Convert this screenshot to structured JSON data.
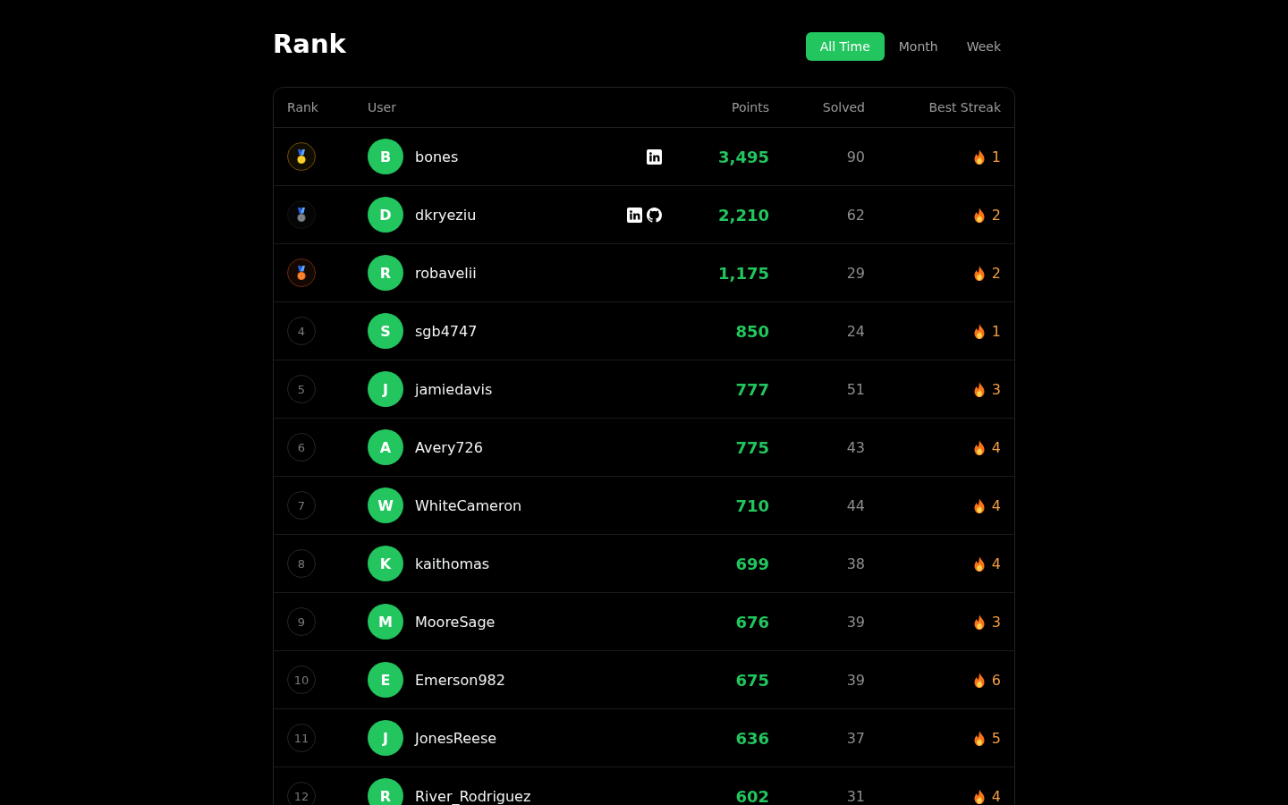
{
  "page": {
    "title": "Rank"
  },
  "tabs": [
    {
      "label": "All Time",
      "selected": true
    },
    {
      "label": "Month",
      "selected": false
    },
    {
      "label": "Week",
      "selected": false
    }
  ],
  "table": {
    "columns": [
      "Rank",
      "User",
      "Points",
      "Solved",
      "Best Streak"
    ],
    "rows": [
      {
        "rank": {
          "kind": "gold"
        },
        "initial": "B",
        "user": "bones",
        "links": [
          {
            "kind": "linkedin"
          }
        ],
        "points": "3,495",
        "solved": "90",
        "streak": "1"
      },
      {
        "rank": {
          "kind": "silver"
        },
        "initial": "D",
        "user": "dkryeziu",
        "links": [
          {
            "kind": "linkedin"
          },
          {
            "kind": "github"
          }
        ],
        "points": "2,210",
        "solved": "62",
        "streak": "2"
      },
      {
        "rank": {
          "kind": "bronze"
        },
        "initial": "R",
        "user": "robavelii",
        "points": "1,175",
        "solved": "29",
        "streak": "2"
      },
      {
        "rank": {
          "kind": "number",
          "label": "4"
        },
        "initial": "S",
        "user": "sgb4747",
        "points": "850",
        "solved": "24",
        "streak": "1"
      },
      {
        "rank": {
          "kind": "number",
          "label": "5"
        },
        "initial": "J",
        "user": "jamiedavis",
        "points": "777",
        "solved": "51",
        "streak": "3"
      },
      {
        "rank": {
          "kind": "number",
          "label": "6"
        },
        "initial": "A",
        "user": "Avery726",
        "points": "775",
        "solved": "43",
        "streak": "4"
      },
      {
        "rank": {
          "kind": "number",
          "label": "7"
        },
        "initial": "W",
        "user": "WhiteCameron",
        "points": "710",
        "solved": "44",
        "streak": "4"
      },
      {
        "rank": {
          "kind": "number",
          "label": "8"
        },
        "initial": "K",
        "user": "kaithomas",
        "points": "699",
        "solved": "38",
        "streak": "4"
      },
      {
        "rank": {
          "kind": "number",
          "label": "9"
        },
        "initial": "M",
        "user": "MooreSage",
        "points": "676",
        "solved": "39",
        "streak": "3"
      },
      {
        "rank": {
          "kind": "number",
          "label": "10"
        },
        "initial": "E",
        "user": "Emerson982",
        "points": "675",
        "solved": "39",
        "streak": "6"
      },
      {
        "rank": {
          "kind": "number",
          "label": "11"
        },
        "initial": "J",
        "user": "JonesReese",
        "points": "636",
        "solved": "37",
        "streak": "5"
      },
      {
        "rank": {
          "kind": "number",
          "label": "12"
        },
        "initial": "R",
        "user": "River_Rodriguez",
        "points": "602",
        "solved": "31",
        "streak": "4"
      }
    ]
  }
}
